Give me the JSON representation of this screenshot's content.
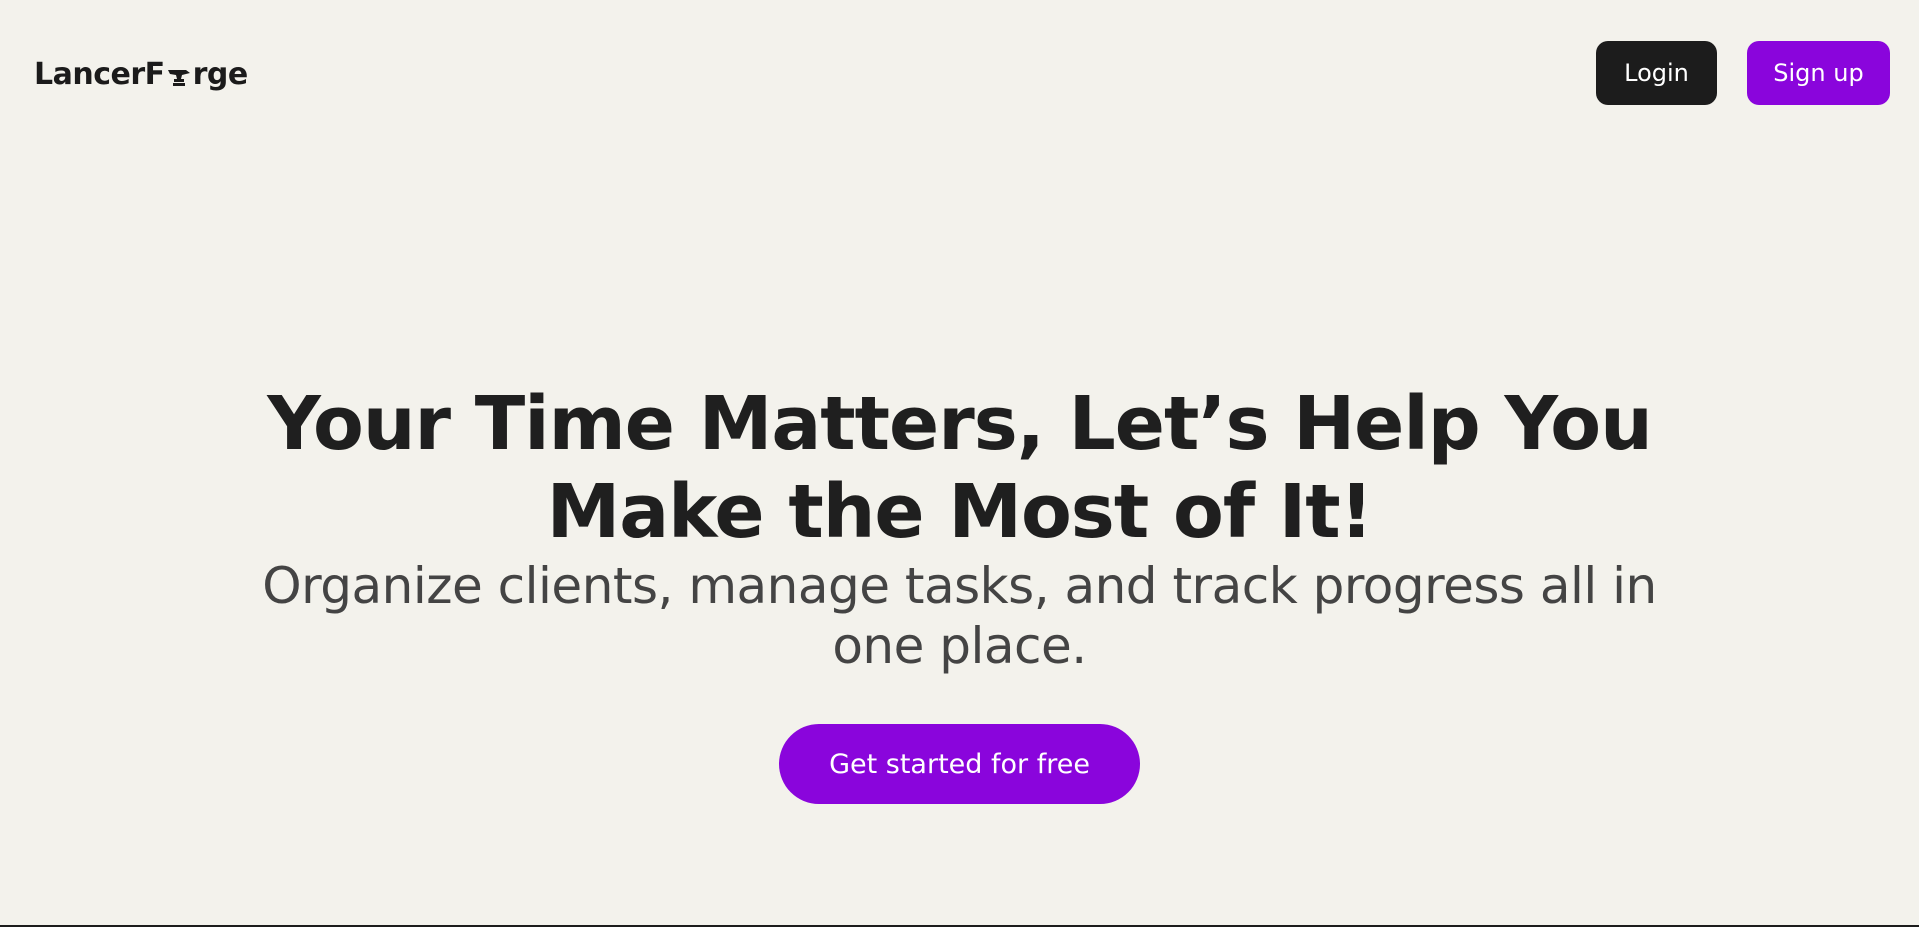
{
  "brand": {
    "name_prefix": "LancerF",
    "name_suffix": "rge",
    "logo_icon": "anvil-icon",
    "color": "#1b1b1b"
  },
  "nav": {
    "login_label": "Login",
    "signup_label": "Sign up",
    "login_color": "#1c1c1c",
    "signup_color": "#8a05dc"
  },
  "hero": {
    "title": "Your Time Matters, Let’s Help You Make the Most of It!",
    "subtitle": "Organize clients, manage tasks, and track progress all in one place.",
    "cta_label": "Get started for free",
    "cta_color": "#8a05dc"
  },
  "theme": {
    "background": "#f3f2ec",
    "text": "#1f1f1f",
    "muted_text": "#444444"
  }
}
